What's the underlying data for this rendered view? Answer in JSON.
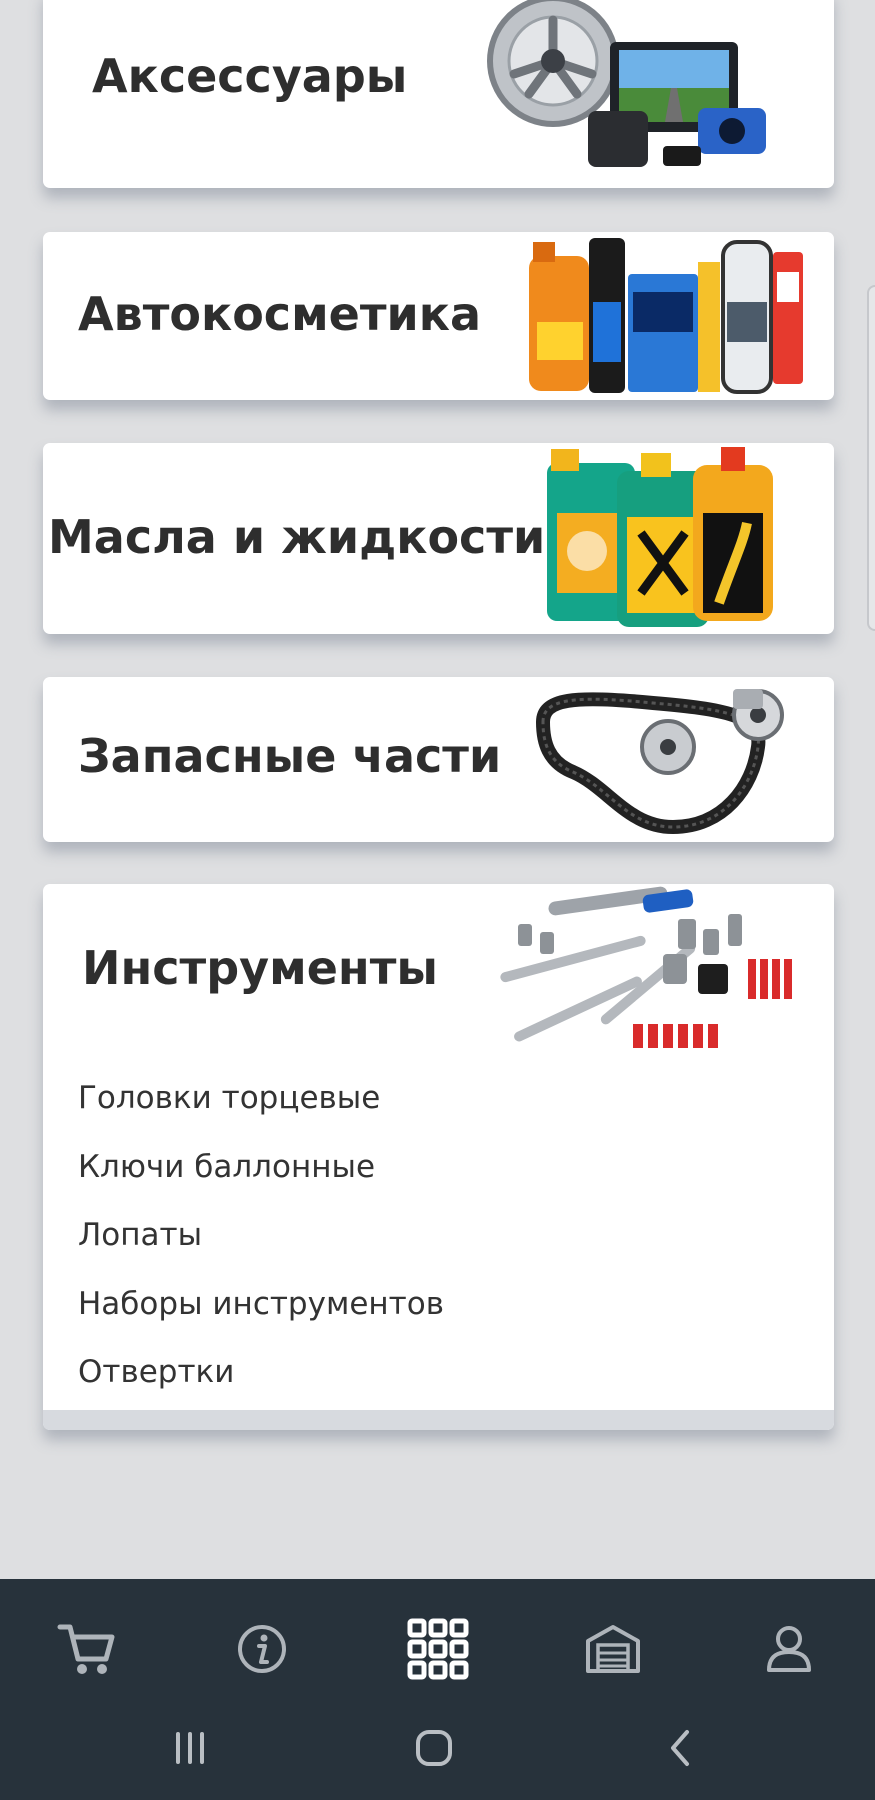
{
  "categories": [
    {
      "title": "Аксессуары"
    },
    {
      "title": "Автокосметика"
    },
    {
      "title": "Масла и жидкости"
    },
    {
      "title": "Запасные части"
    },
    {
      "title": "Инструменты",
      "subitems": [
        "Головки торцевые",
        "Ключи баллонные",
        "Лопаты",
        "Наборы инструментов",
        "Отвертки"
      ]
    }
  ],
  "bottom_nav": {
    "items": [
      {
        "icon": "cart-icon"
      },
      {
        "icon": "info-icon"
      },
      {
        "icon": "catalog-grid-icon",
        "active": true
      },
      {
        "icon": "garage-icon"
      },
      {
        "icon": "profile-icon"
      }
    ]
  },
  "system_nav": {
    "items": [
      {
        "icon": "recent-apps-icon"
      },
      {
        "icon": "home-icon"
      },
      {
        "icon": "back-icon"
      }
    ]
  },
  "colors": {
    "background": "#dedfe1",
    "card": "#ffffff",
    "nav_bar": "#27323b",
    "nav_icon": "#aeb4ba",
    "nav_icon_active": "#ffffff",
    "text": "#2e2e2e"
  }
}
